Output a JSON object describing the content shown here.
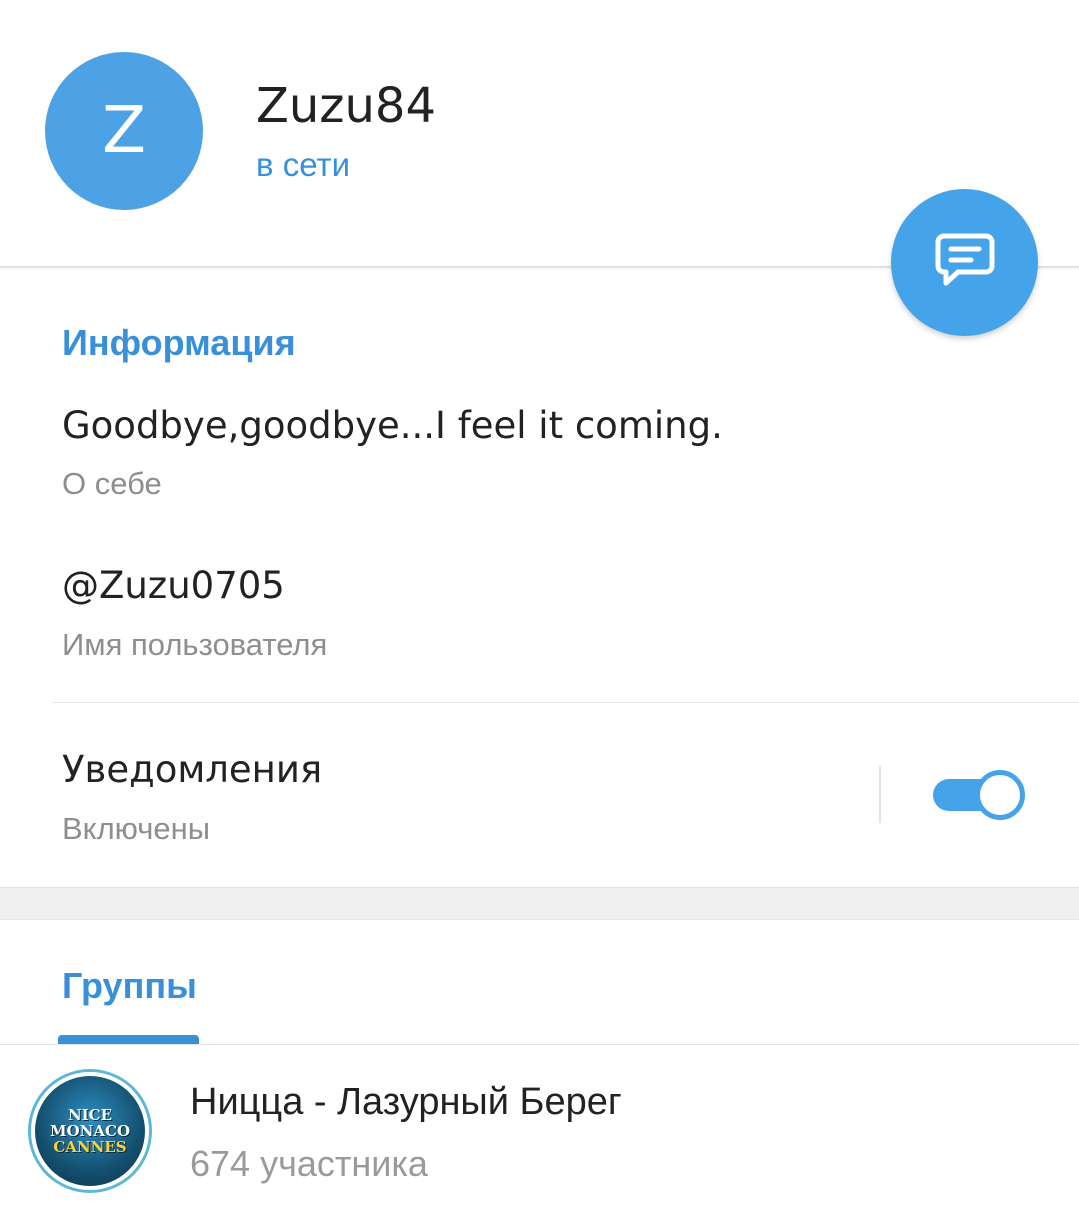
{
  "profile": {
    "avatar_letter": "Z",
    "name": "Zuzu84",
    "status": "в сети"
  },
  "fab": {
    "icon": "message-icon"
  },
  "info": {
    "title": "Информация",
    "bio": {
      "value": "Goodbye,goodbye...I feel it coming.",
      "label": "О себе"
    },
    "username": {
      "value": "@Zuzu0705",
      "label": "Имя пользователя"
    },
    "notifications": {
      "value": "Уведомления",
      "label": "Включены",
      "enabled": true
    }
  },
  "groups": {
    "tab_label": "Группы",
    "items": [
      {
        "name": "Ницца - Лазурный Берег",
        "members": "674 участника",
        "avatar_text": [
          "NICE",
          "MONACO",
          "CANNES"
        ]
      }
    ]
  },
  "colors": {
    "accent": "#3a8fd9",
    "fab": "#45a3ea",
    "avatar": "#4da2e6"
  }
}
